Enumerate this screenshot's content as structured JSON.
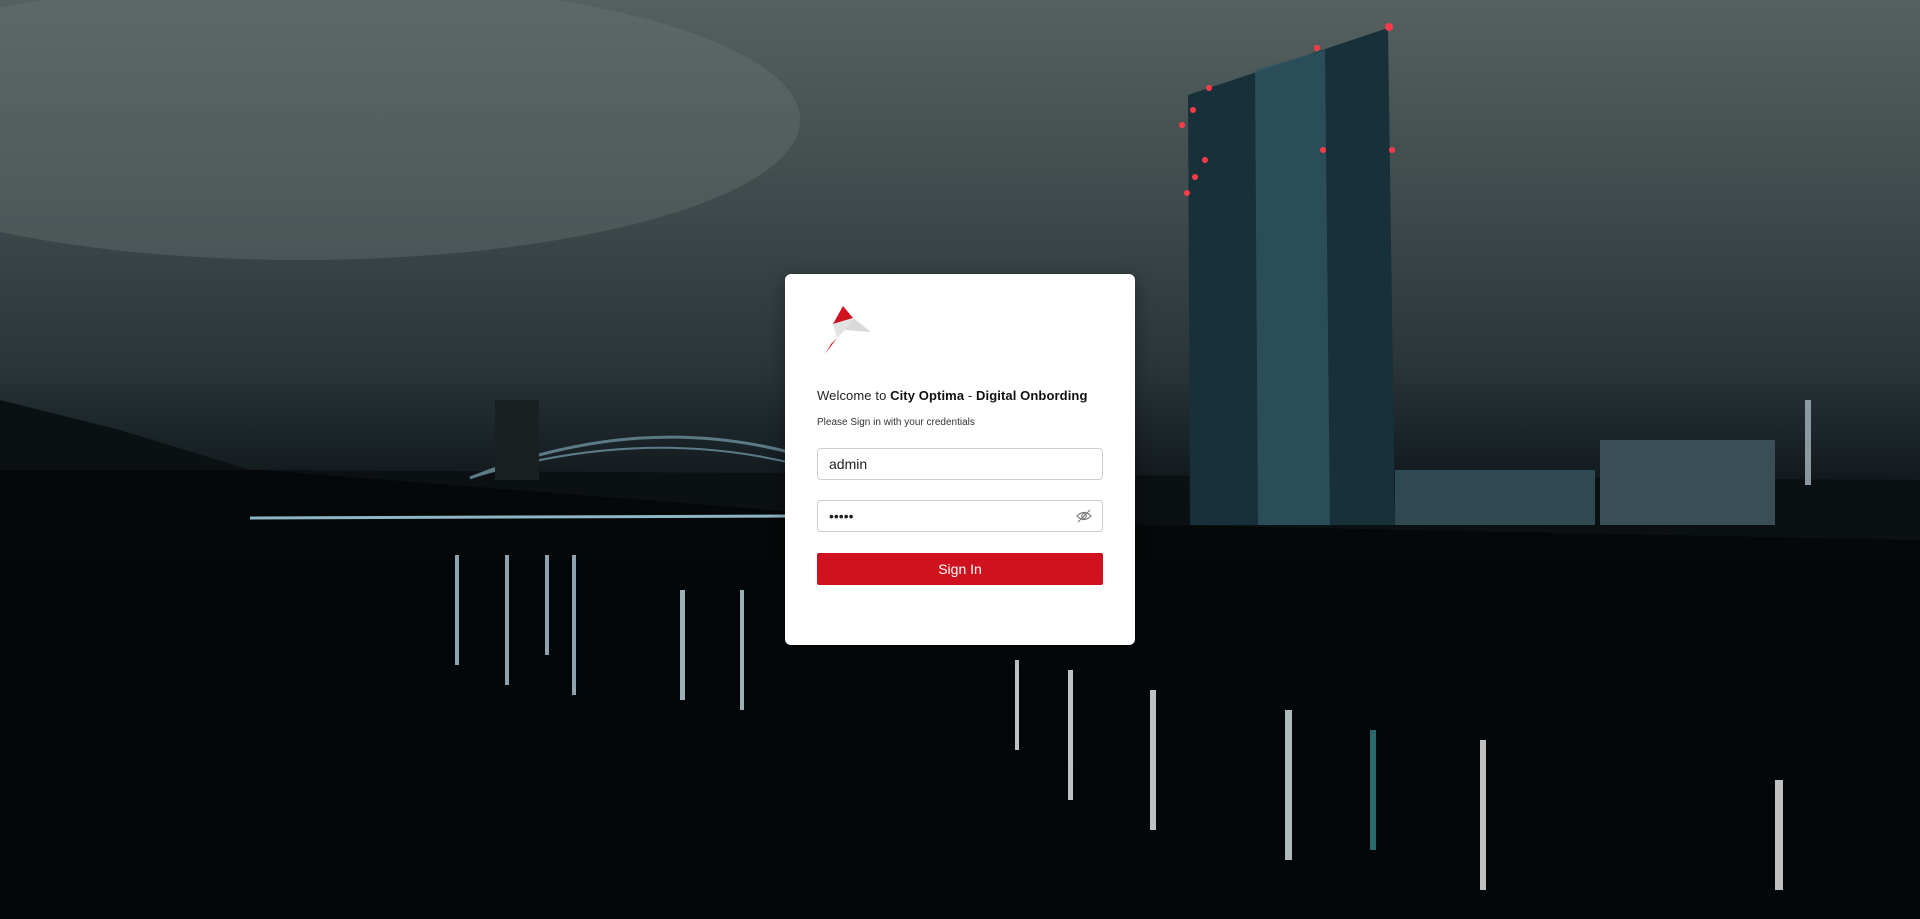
{
  "login": {
    "welcome_prefix": "Welcome to ",
    "brand": "City Optima",
    "separator": " - ",
    "product": "Digital Onbording",
    "subtitle": "Please Sign in with your credentials",
    "username_value": "admin",
    "password_value": "admin",
    "signin_label": "Sign In"
  },
  "icons": {
    "logo": "city-optima-logo",
    "password_toggle": "eye-slash-icon"
  },
  "colors": {
    "accent": "#d0121e",
    "card_background": "#ffffff"
  }
}
